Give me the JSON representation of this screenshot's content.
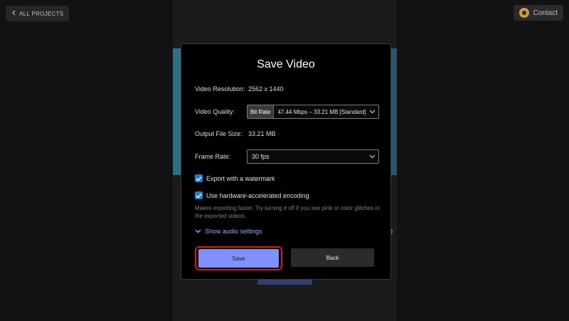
{
  "topbar": {
    "all_projects_label": "ALL PROJECTS",
    "contact_label": "Contact"
  },
  "background": {
    "side_text": "0"
  },
  "dialog": {
    "title": "Save Video",
    "resolution": {
      "label": "Video Resolution:",
      "value": "2562 x 1440"
    },
    "quality": {
      "label": "Video Quality:",
      "mode": "Bit Rate",
      "value": "47.44 Mbps – 33.21 MB [Standard]"
    },
    "file_size": {
      "label": "Output File Size:",
      "value": "33.21 MB"
    },
    "frame_rate": {
      "label": "Frame Rate:",
      "value": "30 fps"
    },
    "watermark": {
      "label": "Export with a watermark",
      "checked": true
    },
    "hw_encoding": {
      "label": "Use hardware-accelerated encoding",
      "checked": true
    },
    "hint": "Makes exporting faster. Try turning it off if you see pink or color glitches in the exported videos.",
    "audio_link": "Show audio settings",
    "save_label": "Save",
    "back_label": "Back"
  },
  "colors": {
    "accent": "#7e91ff",
    "checkbox": "#1e7fd6",
    "highlight_outline": "#e0121b",
    "link": "#8fa9ff"
  }
}
